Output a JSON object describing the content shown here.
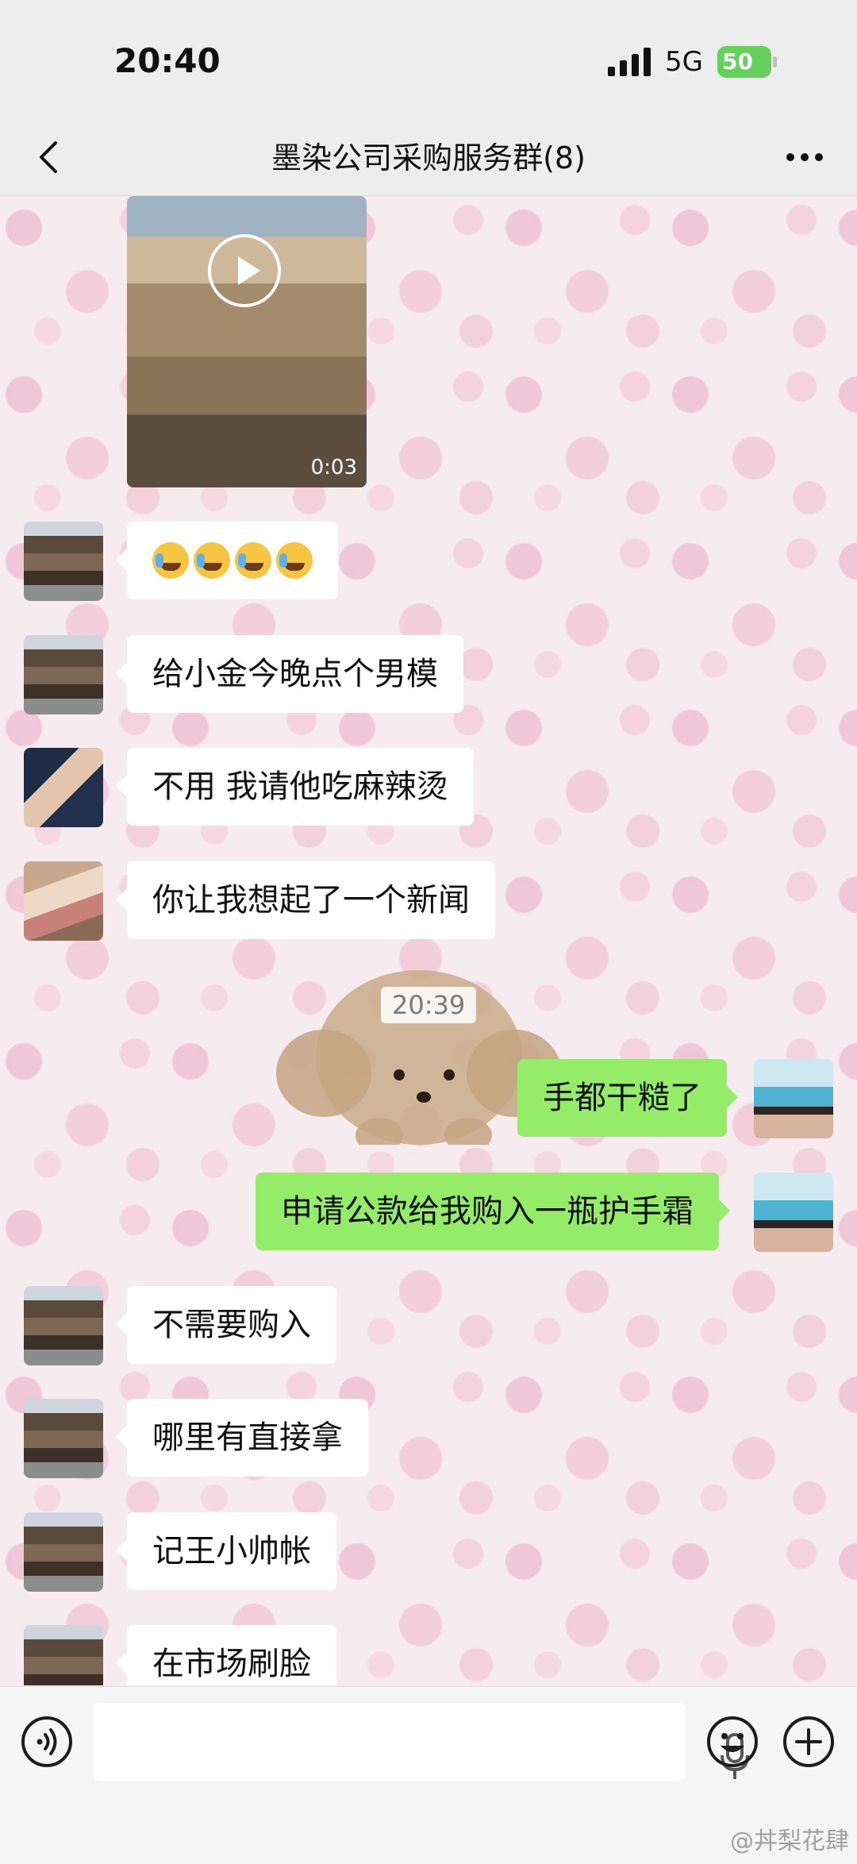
{
  "status_bar": {
    "time": "20:40",
    "network": "5G",
    "battery": "50"
  },
  "nav": {
    "title": "墨染公司采购服务群(8)",
    "back_icon": "chevron-left-icon",
    "more_icon": "more-dots-icon"
  },
  "chat": {
    "video": {
      "duration": "0:03",
      "icon": "play-icon"
    },
    "messages": [
      {
        "side": "in",
        "text": "😭😭😭😭",
        "emoji": true
      },
      {
        "side": "in",
        "text": "给小金今晚点个男模"
      },
      {
        "side": "in",
        "text": "不用 我请他吃麻辣烫"
      },
      {
        "side": "in",
        "text": "你让我想起了一个新闻"
      },
      {
        "side": "out",
        "text": "手都干糙了"
      },
      {
        "side": "out",
        "text": "申请公款给我购入一瓶护手霜"
      },
      {
        "side": "in",
        "text": "不需要购入"
      },
      {
        "side": "in",
        "text": "哪里有直接拿"
      },
      {
        "side": "in",
        "text": "记王小帅帐"
      },
      {
        "side": "in",
        "text": "在市场刷脸"
      }
    ],
    "timestamp": "20:39"
  },
  "input_bar": {
    "voice_icon": "voice-icon",
    "mic_icon": "microphone-icon",
    "emoji_icon": "emoji-face-icon",
    "plus_icon": "plus-icon"
  },
  "watermark": "@丼梨花肆",
  "colors": {
    "outgoing_bubble": "#95ec69",
    "incoming_bubble": "#ffffff",
    "battery": "#63d15a"
  }
}
